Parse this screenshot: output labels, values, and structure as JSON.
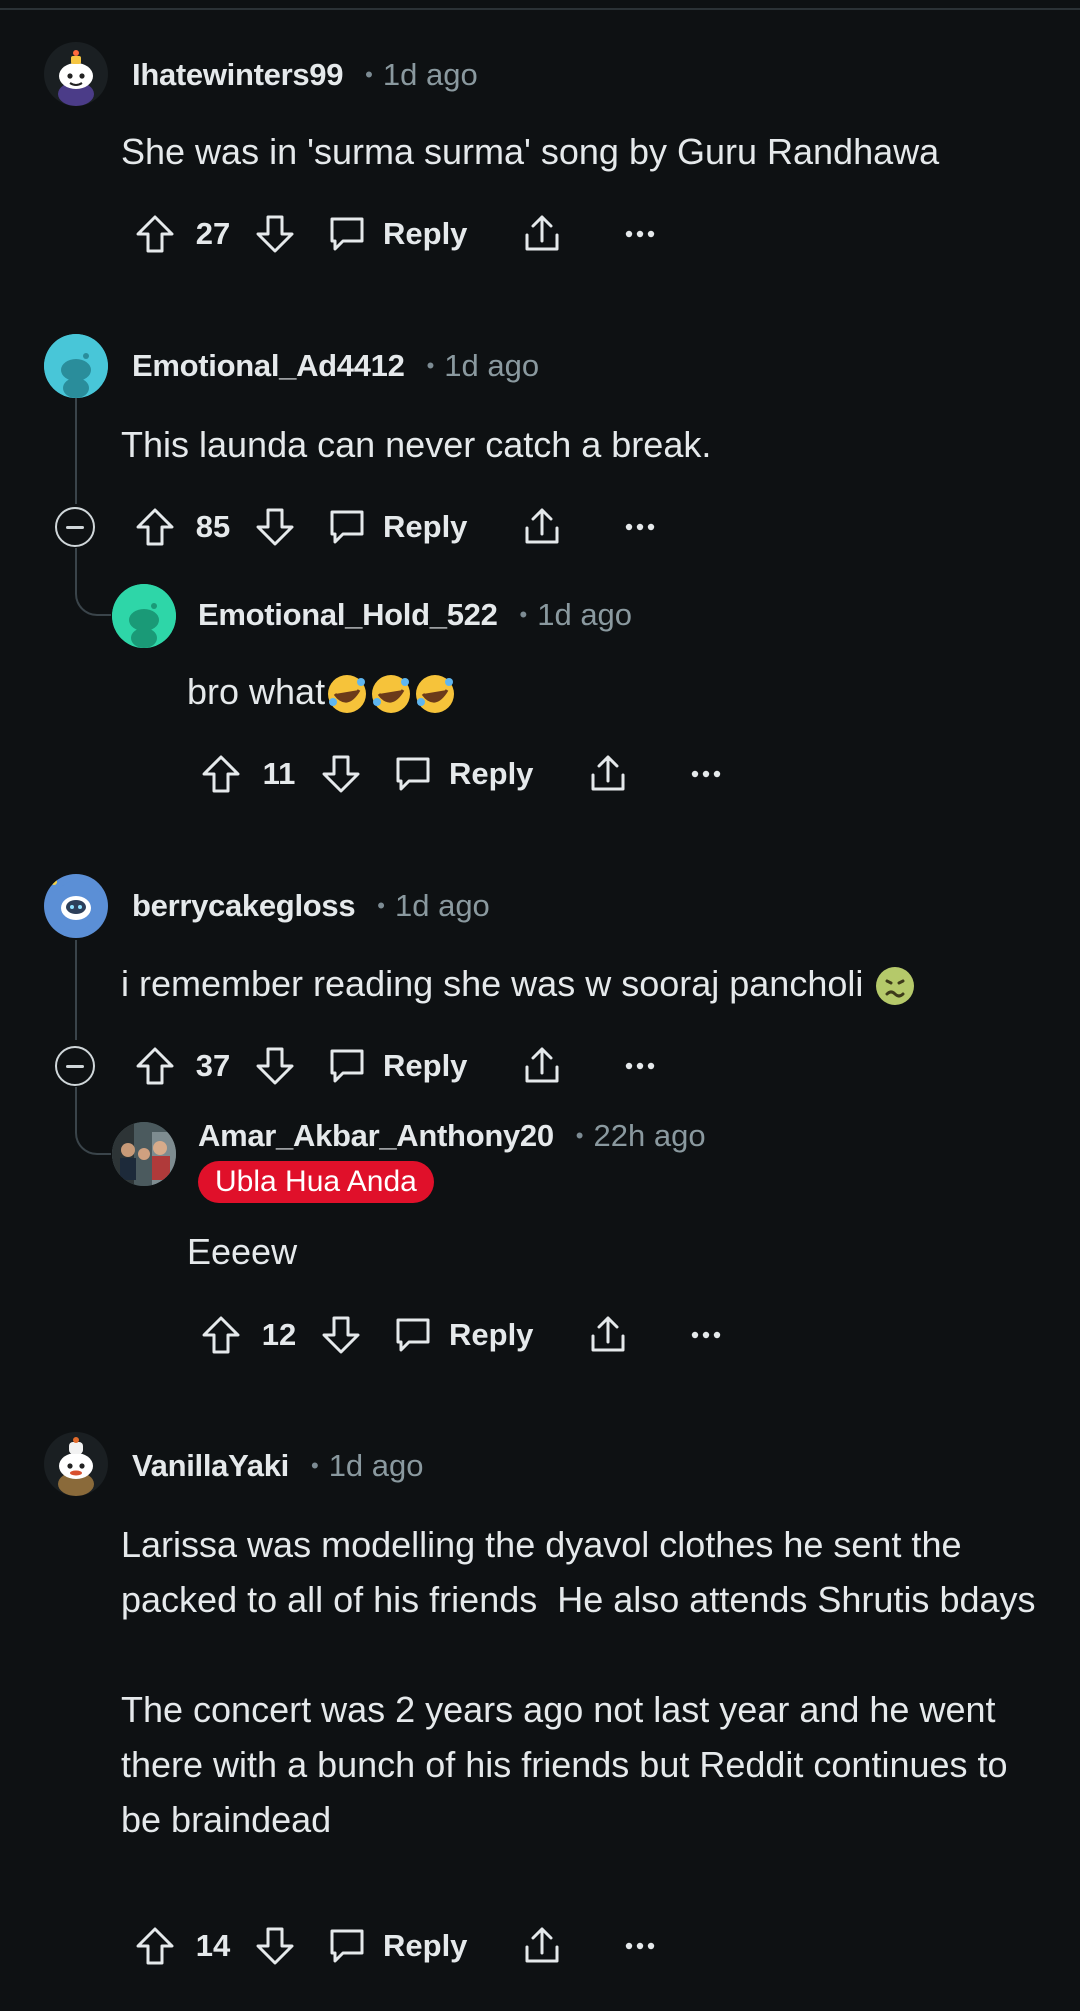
{
  "colors": {
    "background": "#0e1113",
    "text": "#e5e9eb",
    "muted": "#8a999f",
    "flair": "#e0102a"
  },
  "actions": {
    "reply_label": "Reply",
    "separator": "•"
  },
  "comments": [
    {
      "user": "Ihatewinters99",
      "time": "1d ago",
      "body": "She was in 'surma surma' song by Guru Randhawa",
      "score": "27",
      "avatar": "snoo-crown-avatar"
    },
    {
      "user": "Emotional_Ad4412",
      "time": "1d ago",
      "body": "This launda can never catch a break.",
      "score": "85",
      "avatar": "snoo-teal-avatar"
    },
    {
      "user": "Emotional_Hold_522",
      "time": "1d ago",
      "body": "bro what",
      "body_emoji": [
        "rolling-on-floor-laughing-emoji",
        "rolling-on-floor-laughing-emoji",
        "rolling-on-floor-laughing-emoji"
      ],
      "score": "11",
      "avatar": "snoo-green-avatar"
    },
    {
      "user": "berrycakegloss",
      "time": "1d ago",
      "body": "i remember reading she was w sooraj pancholi",
      "body_emoji": [
        "nauseated-face-emoji"
      ],
      "score": "37",
      "avatar": "snoo-astronaut-avatar"
    },
    {
      "user": "Amar_Akbar_Anthony20",
      "time": "22h ago",
      "flair": "Ubla Hua Anda",
      "body": "Eeeew",
      "score": "12",
      "avatar": "photo-avatar"
    },
    {
      "user": "VanillaYaki",
      "time": "1d ago",
      "body": "Larissa was modelling the dyavol clothes he sent the packed to all of his friends  He also attends Shrutis bdays\n\nThe concert was 2 years ago not last year and he went there with a bunch of his friends but Reddit continues to be braindead",
      "score": "14",
      "avatar": "snoo-chef-avatar"
    }
  ]
}
